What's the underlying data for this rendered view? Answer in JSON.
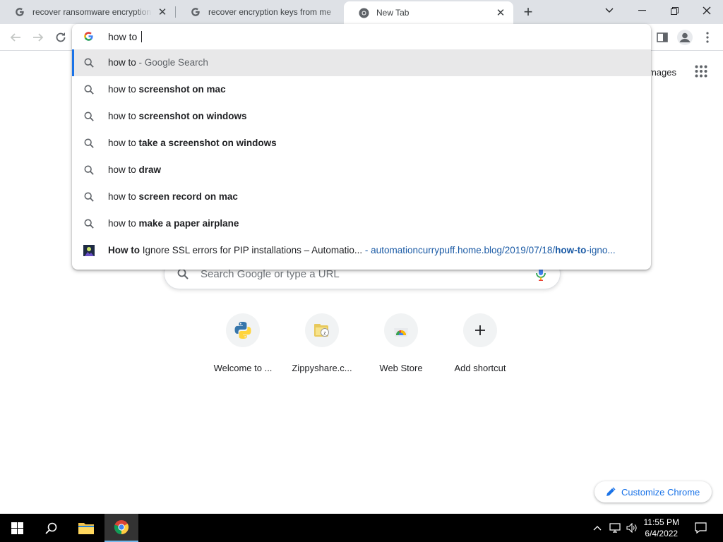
{
  "tabs": [
    {
      "title": "recover ransomware encryption k",
      "favicon": "google-g-icon",
      "active": false
    },
    {
      "title": "recover encryption keys from me",
      "favicon": "google-g-icon",
      "active": false
    },
    {
      "title": "New Tab",
      "favicon": "chrome-icon",
      "active": true
    }
  ],
  "omnibox": {
    "text": "how to ",
    "suggestions": [
      {
        "prefix": "how to",
        "bold": "",
        "suffix": " - Google Search",
        "icon": "search-icon",
        "selected": true
      },
      {
        "prefix": "how to ",
        "bold": "screenshot on mac",
        "icon": "search-icon"
      },
      {
        "prefix": "how to ",
        "bold": "screenshot on windows",
        "icon": "search-icon"
      },
      {
        "prefix": "how to ",
        "bold": "take a screenshot on windows",
        "icon": "search-icon"
      },
      {
        "prefix": "how to ",
        "bold": "draw",
        "icon": "search-icon"
      },
      {
        "prefix": "how to ",
        "bold": "screen record on mac",
        "icon": "search-icon"
      },
      {
        "prefix": "how to ",
        "bold": "make a paper airplane",
        "icon": "search-icon"
      }
    ],
    "history": {
      "title_bold": "How to",
      "title_rest": " Ignore SSL errors for PIP installations – Automatio...",
      "sep": " - ",
      "url_pre": "automationcurrypuff.home.blog/2019/07/18/",
      "url_bold": "how-to",
      "url_post": "-igno..."
    }
  },
  "ntp": {
    "images_link": "Images",
    "search_placeholder": "Search Google or type a URL",
    "shortcuts": [
      {
        "label": "Welcome to ...",
        "icon": "python-icon"
      },
      {
        "label": "Zippyshare.c...",
        "icon": "zippyshare-icon"
      },
      {
        "label": "Web Store",
        "icon": "web-store-icon"
      },
      {
        "label": "Add shortcut",
        "icon": "plus-icon"
      }
    ],
    "customize_label": "Customize Chrome"
  },
  "taskbar": {
    "time": "11:55 PM",
    "date": "6/4/2022"
  },
  "colors": {
    "accent": "#1a73e8",
    "tabstrip": "#dee1e6",
    "taskbar": "#000000"
  }
}
